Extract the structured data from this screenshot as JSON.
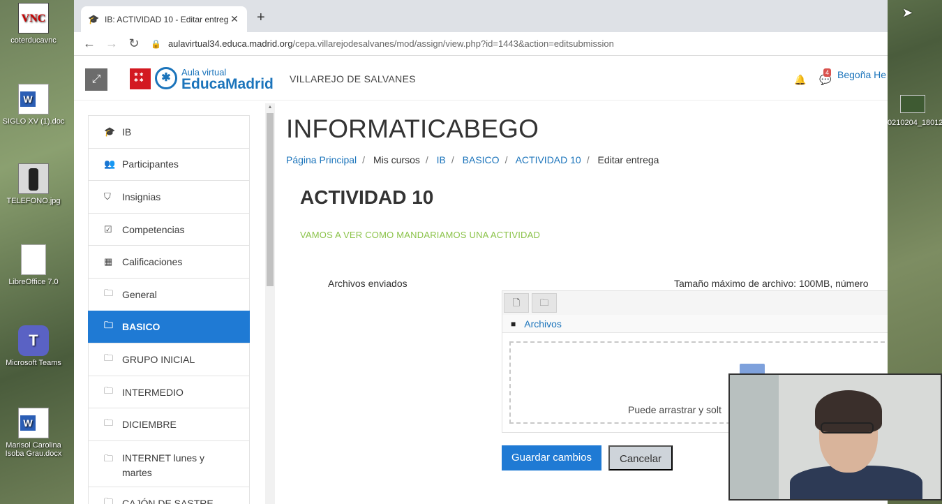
{
  "desktop": {
    "icons": [
      {
        "label": "coterducavnc"
      },
      {
        "label": "SIGLO XV (1).doc"
      },
      {
        "label": "TELEFONO.jpg"
      },
      {
        "label": "LibreOffice 7.0"
      },
      {
        "label": "Microsoft Teams"
      },
      {
        "label": "Marisol Carolina Isoba Grau.docx"
      }
    ],
    "right_label": "0210204_18012."
  },
  "browser": {
    "tab_title": "IB: ACTIVIDAD 10 - Editar entreg",
    "url_host": "aulavirtual34.educa.madrid.org",
    "url_path": "/cepa.villarejodesalvanes/mod/assign/view.php?id=1443&action=editsubmission"
  },
  "site": {
    "logo_top": "Aula virtual",
    "logo_main": "EducaMadrid",
    "name": "VILLAREJO DE SALVANES",
    "notif_count": "4",
    "user_name": "Begoña He"
  },
  "nav": [
    {
      "label": "IB",
      "icon": "graduation-cap-icon"
    },
    {
      "label": "Participantes",
      "icon": "users-icon"
    },
    {
      "label": "Insignias",
      "icon": "shield-icon"
    },
    {
      "label": "Competencias",
      "icon": "checkbox-icon"
    },
    {
      "label": "Calificaciones",
      "icon": "table-icon"
    },
    {
      "label": "General",
      "icon": "folder-icon"
    },
    {
      "label": "BASICO",
      "icon": "folder-icon"
    },
    {
      "label": "GRUPO INICIAL",
      "icon": "folder-icon"
    },
    {
      "label": "INTERMEDIO",
      "icon": "folder-icon"
    },
    {
      "label": "DICIEMBRE",
      "icon": "folder-icon"
    },
    {
      "label": "INTERNET lunes y martes",
      "icon": "folder-icon"
    },
    {
      "label": "CAJÓN DE SASTRE",
      "icon": "folder-icon"
    }
  ],
  "main": {
    "course_title": "INFORMATICABEGO",
    "breadcrumb": [
      "Página Principal",
      "Mis cursos",
      "IB",
      "BASICO",
      "ACTIVIDAD 10",
      "Editar entrega"
    ],
    "activity_title": "ACTIVIDAD 10",
    "activity_desc": "VAMOS A VER COMO MANDARIAMOS UNA ACTIVIDAD",
    "files_label": "Archivos enviados",
    "max_size": "Tamaño máximo de archivo: 100MB, número",
    "fp_path": "Archivos",
    "drop_text": "Puede arrastrar y solt",
    "save_label": "Guardar cambios",
    "cancel_label": "Cancelar"
  }
}
